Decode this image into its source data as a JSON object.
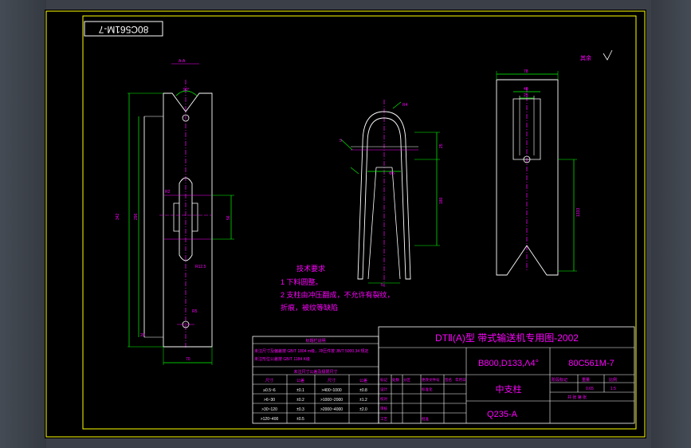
{
  "colors": {
    "background": "#000000",
    "frame": "#ffff00",
    "outline": "#ffffff",
    "dimension": "#00ff00",
    "center_line": "#ff00ff",
    "annotation": "#ff00ff",
    "chrome": "#3b4048"
  },
  "drawing_number_box": "80C561M-7",
  "surface_mark": "其余",
  "views": {
    "left": {
      "section_label": "A-A",
      "angle": "90°",
      "dim_height_1": "342",
      "dim_height_2": "296",
      "dim_slot": "56",
      "dim_width": "70",
      "radius_1": "R2",
      "radius_2": "R12.5",
      "radius_3": "R5",
      "dim_small": "20"
    },
    "middle": {
      "radius_top": "R4",
      "dim_width": "Φ5",
      "dim_height_top": "25",
      "dim_height_mid": "180",
      "angle": "4°",
      "dim_bottom": "5"
    },
    "right": {
      "dim_width_1": "78",
      "dim_width_2": "40",
      "dim_width_3": "25",
      "dim_height": "1333"
    }
  },
  "notes": {
    "title": "技术要求",
    "lines": [
      "1 下料圆整。",
      "2 支柱由冲压翻成，不允许有裂纹，",
      "  折痕，被纹等缺陷"
    ]
  },
  "tolerance_table": {
    "header": "标题栏说明",
    "lines": [
      "未注尺寸及偏差按 GB/T 1804 m级，冲压件按 JB/T 5000.34 规定",
      "未注形位公差按 GB/T 1184 K级"
    ],
    "sub_header": "未注尺寸公差及极限尺寸",
    "columns": [
      "尺寸",
      "公差",
      "尺寸",
      "公差"
    ],
    "rows": [
      [
        "≥0.5~6",
        "±0.1",
        ">400~1000",
        "±0.8"
      ],
      [
        ">6~30",
        "±0.2",
        ">1000~2000",
        "±1.2"
      ],
      [
        ">30~120",
        "±0.3",
        ">2000~4000",
        "±2.0"
      ],
      [
        ">120~400",
        "±0.5",
        "",
        ""
      ]
    ]
  },
  "title_block": {
    "main_title": "DTⅡ(A)型  带式输送机专用图-2002",
    "spec": "B800,D133,Λ4°",
    "drawing_number": "80C561M-7",
    "part_name": "中支柱",
    "material": "Q235-A",
    "sign_rows": [
      "标记",
      "处数",
      "分区",
      "更改文件号",
      "签名",
      "年月日"
    ],
    "sign_labels": [
      "设计",
      "校对",
      "审核",
      "工艺"
    ],
    "standard_label": "标准化",
    "approve_label": "批准",
    "stage_label": "阶段标记",
    "weight_label": "重量",
    "scale_label": "比例",
    "weight_value": "0.65",
    "scale_value": "1:5",
    "sheet_label": "共   张   第   张"
  }
}
